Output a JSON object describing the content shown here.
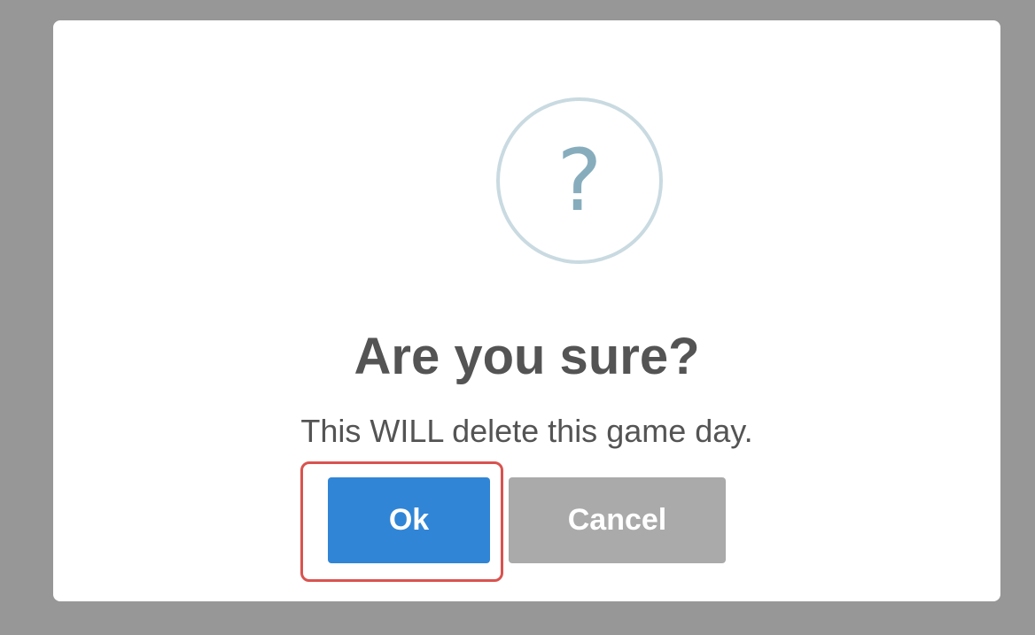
{
  "dialog": {
    "icon": "question-icon",
    "icon_glyph": "?",
    "title": "Are you sure?",
    "text": "This WILL delete this game day.",
    "ok_label": "Ok",
    "cancel_label": "Cancel"
  },
  "colors": {
    "overlay": "#979797",
    "ok_button": "#3085d6",
    "cancel_button": "#aaaaaa",
    "icon_ring": "#c9dae1",
    "icon_glyph": "#87adbd",
    "focus_highlight": "#d9534f"
  }
}
